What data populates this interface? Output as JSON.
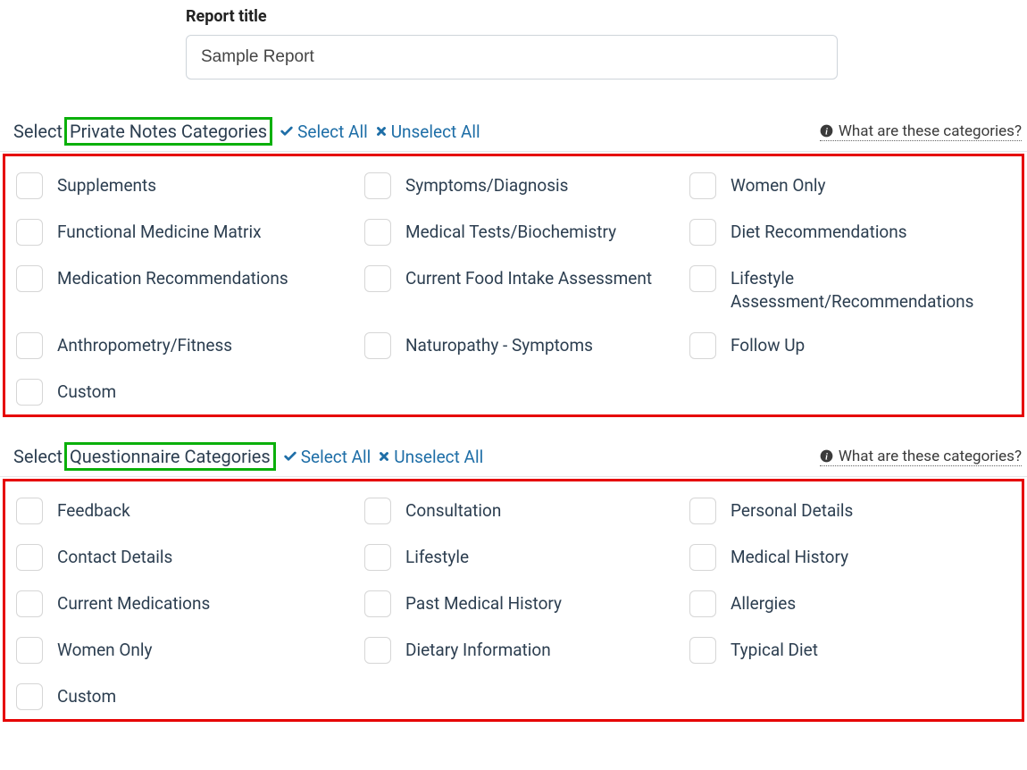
{
  "title": {
    "label": "Report title",
    "value": "Sample Report"
  },
  "privateNotes": {
    "selectLabel": "Select",
    "titleBox": "Private Notes Categories",
    "selectAll": "Select All",
    "unselectAll": "Unselect All",
    "helpText": "What are these categories?",
    "items": [
      {
        "label": "Supplements"
      },
      {
        "label": "Symptoms/Diagnosis"
      },
      {
        "label": "Women Only"
      },
      {
        "label": "Functional Medicine Matrix"
      },
      {
        "label": "Medical Tests/Biochemistry"
      },
      {
        "label": "Diet Recommendations"
      },
      {
        "label": "Medication Recommendations"
      },
      {
        "label": "Current Food Intake Assessment"
      },
      {
        "label": "Lifestyle Assessment/Recommendations"
      },
      {
        "label": "Anthropometry/Fitness"
      },
      {
        "label": "Naturopathy - Symptoms"
      },
      {
        "label": "Follow Up"
      },
      {
        "label": "Custom"
      }
    ]
  },
  "questionnaire": {
    "selectLabel": "Select",
    "titleBox": "Questionnaire Categories",
    "selectAll": "Select All",
    "unselectAll": "Unselect All",
    "helpText": "What are these categories?",
    "items": [
      {
        "label": "Feedback"
      },
      {
        "label": "Consultation"
      },
      {
        "label": "Personal Details"
      },
      {
        "label": "Contact Details"
      },
      {
        "label": "Lifestyle"
      },
      {
        "label": "Medical History"
      },
      {
        "label": "Current Medications"
      },
      {
        "label": "Past Medical History"
      },
      {
        "label": "Allergies"
      },
      {
        "label": "Women Only"
      },
      {
        "label": "Dietary Information"
      },
      {
        "label": "Typical Diet"
      },
      {
        "label": "Custom"
      }
    ]
  }
}
